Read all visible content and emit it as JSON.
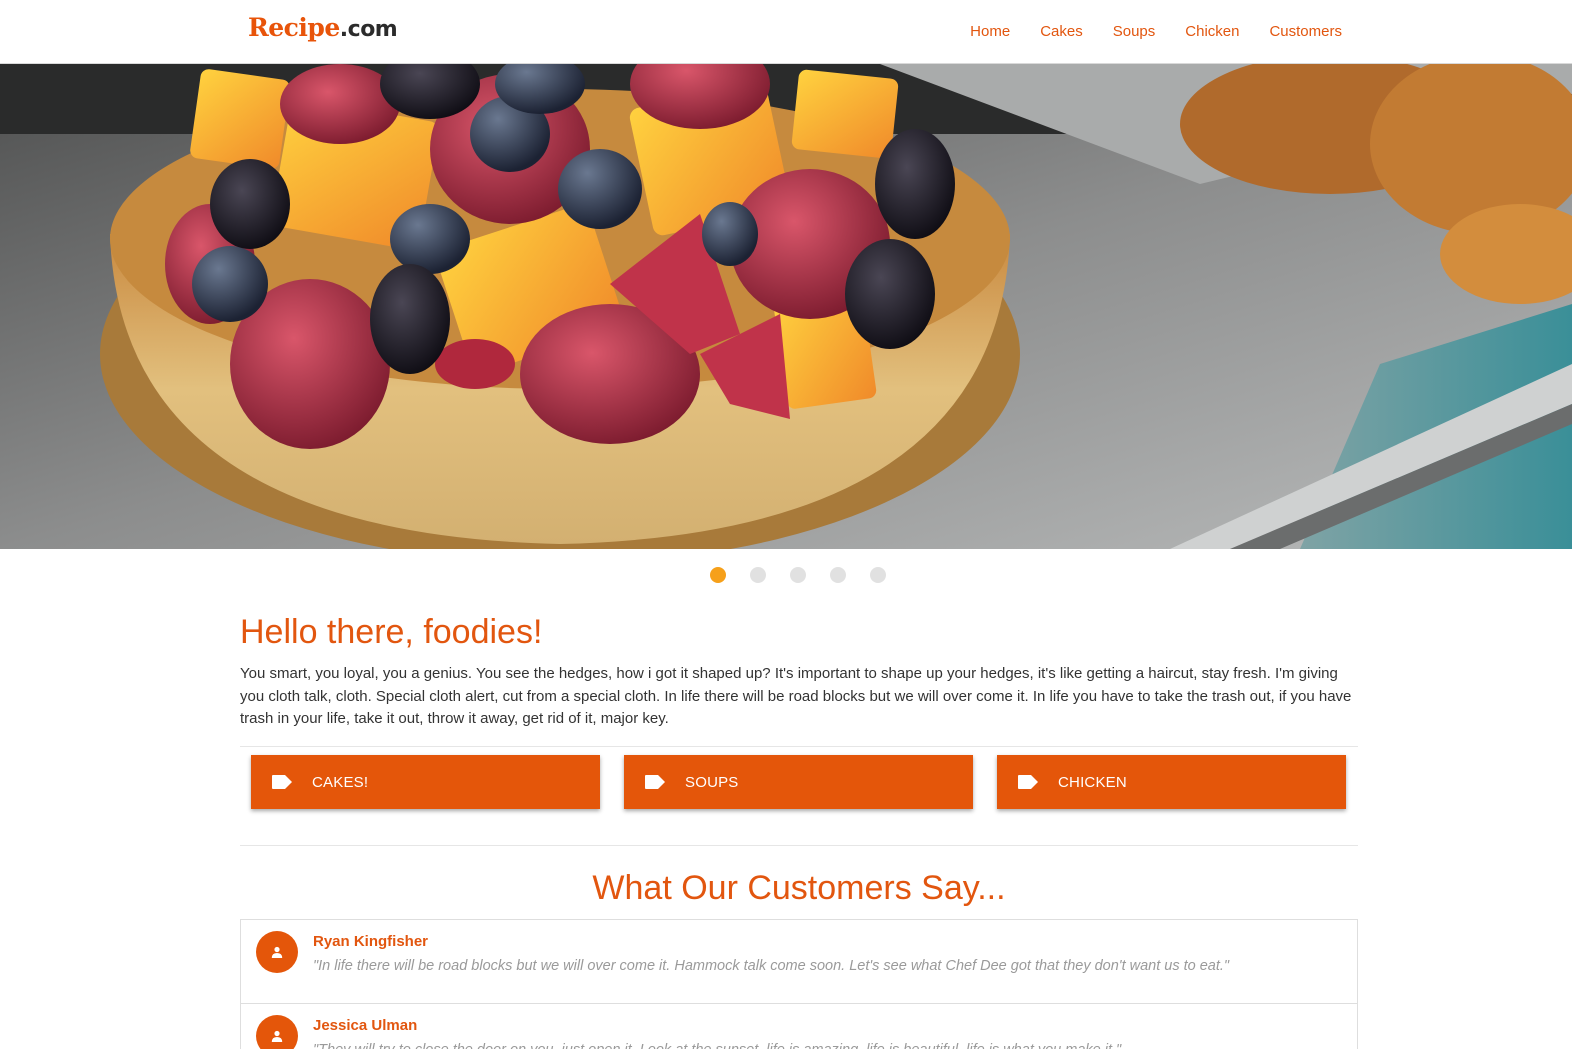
{
  "nav": {
    "logo_part1": "Recipe",
    "logo_part2": ".com",
    "links": [
      "Home",
      "Cakes",
      "Soups",
      "Chicken",
      "Customers"
    ]
  },
  "hero": {
    "image_description": "fruit tart with raspberries, blueberries, blackberries and peach cubes on a metal baking tray",
    "slide_count": 5,
    "active_slide": 1
  },
  "intro": {
    "title": "Hello there, foodies!",
    "text": "You smart, you loyal, you a genius. You see the hedges, how i got it shaped up? It's important to shape up your hedges, it's like getting a haircut, stay fresh. I'm giving you cloth talk, cloth. Special cloth alert, cut from a special cloth. In life there will be road blocks but we will over come it. In life you have to take the trash out, if you have trash in your life, take it out, throw it away, get rid of it, major key."
  },
  "categories": [
    {
      "label": "CAKES!",
      "icon": "tag-icon"
    },
    {
      "label": "SOUPS",
      "icon": "tag-icon"
    },
    {
      "label": "CHICKEN",
      "icon": "tag-icon"
    }
  ],
  "testimonials": {
    "title": "What Our Customers Say...",
    "items": [
      {
        "name": "Ryan Kingfisher",
        "quote": "\"In life there will be road blocks but we will over come it. Hammock talk come soon. Let's see what Chef Dee got that they don't want us to eat.\"",
        "icon": "person-icon"
      },
      {
        "name": "Jessica Ulman",
        "quote": "\"They will try to close the door on you, just open it. Look at the sunset, life is amazing, life is beautiful, life is what you make it.\"",
        "icon": "person-icon"
      }
    ]
  },
  "colors": {
    "accent": "#e4560a",
    "active_dot": "#f6a01a",
    "inactive_dot": "#e1e1e1"
  }
}
